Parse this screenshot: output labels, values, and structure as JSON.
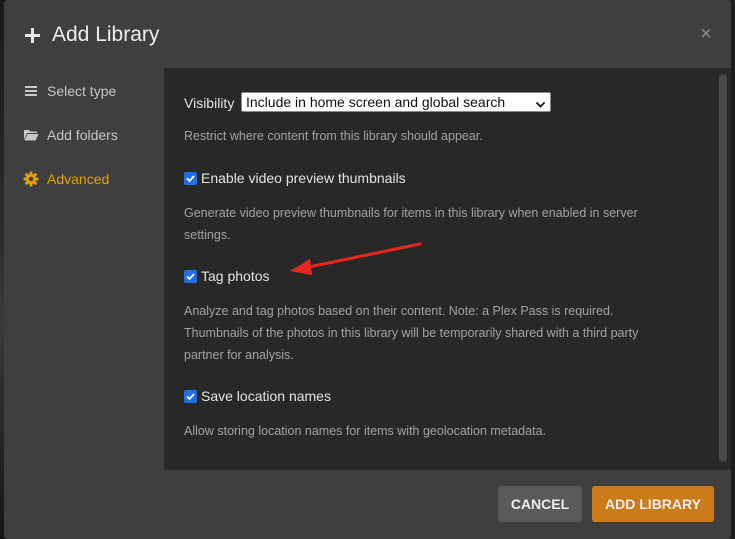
{
  "dialog": {
    "title": "Add Library",
    "close_symbol": "×"
  },
  "sidebar": {
    "items": [
      {
        "label": "Select type",
        "icon": "list-icon",
        "active": false
      },
      {
        "label": "Add folders",
        "icon": "folder-icon",
        "active": false
      },
      {
        "label": "Advanced",
        "icon": "gear-icon",
        "active": true
      }
    ]
  },
  "advanced": {
    "visibility": {
      "label": "Visibility",
      "selected": "Include in home screen and global search",
      "description": "Restrict where content from this library should appear."
    },
    "options": [
      {
        "label": "Enable video preview thumbnails",
        "checked": true,
        "description_lines": [
          "Generate video preview thumbnails for items in this library when enabled in server",
          "settings."
        ]
      },
      {
        "label": "Tag photos",
        "checked": true,
        "description_lines": [
          "Analyze and tag photos based on their content. Note: a Plex Pass is required.",
          "Thumbnails of the photos in this library will be temporarily shared with a third party",
          "partner for analysis."
        ]
      },
      {
        "label": "Save location names",
        "checked": true,
        "description_lines": [
          "Allow storing location names for items with geolocation metadata."
        ]
      }
    ]
  },
  "footer": {
    "cancel_label": "CANCEL",
    "add_label": "ADD LIBRARY"
  },
  "colors": {
    "accent": "#e5a00d",
    "add_button": "#cc7b19",
    "checkbox": "#1f6fe5",
    "annotation_arrow": "#e8281e"
  }
}
